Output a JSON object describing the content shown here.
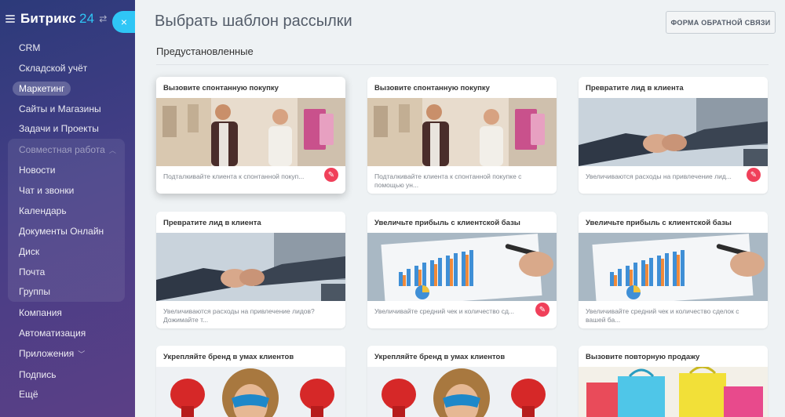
{
  "sidebar": {
    "logo_text": "Битрикс",
    "logo_number": "24",
    "pin_glyph": "⇄",
    "items": [
      {
        "label": "CRM"
      },
      {
        "label": "Складской учёт"
      },
      {
        "label": "Маркетинг"
      },
      {
        "label": "Сайты и Магазины"
      },
      {
        "label": "Задачи и Проекты"
      },
      {
        "label": "Совместная работа"
      },
      {
        "label": "Новости"
      },
      {
        "label": "Чат и звонки"
      },
      {
        "label": "Календарь"
      },
      {
        "label": "Документы Онлайн"
      },
      {
        "label": "Диск"
      },
      {
        "label": "Почта"
      },
      {
        "label": "Группы"
      },
      {
        "label": "Компания"
      },
      {
        "label": "Автоматизация"
      },
      {
        "label": "Приложения"
      },
      {
        "label": "Подпись"
      },
      {
        "label": "Ещё"
      }
    ]
  },
  "close_glyph": "×",
  "header": {
    "title": "Выбрать шаблон рассылки",
    "feedback_button": "ФОРМА ОБРАТНОЙ СВЯЗИ"
  },
  "section": {
    "title": "Предустановленные"
  },
  "cards": [
    {
      "title": "Вызовите спонтанную покупку",
      "desc": "Подталкивайте клиента к спонтанной покуп...",
      "image": "shopping-couple"
    },
    {
      "title": "Вызовите спонтанную покупку",
      "desc": "Подталкивайте клиента к спонтанной покупке с помощью ун...",
      "image": "shopping-couple"
    },
    {
      "title": "Превратите лид в клиента",
      "desc": "Увеличиваются расходы на привлечение лид...",
      "image": "handshake"
    },
    {
      "title": "Превратите лид в клиента",
      "desc": "Увеличиваются расходы на привлечение лидов? Дожимайте т...",
      "image": "handshake"
    },
    {
      "title": "Увеличьте прибыль с клиентской базы",
      "desc": "Увеличивайте средний чек и количество сд...",
      "image": "sales-chart"
    },
    {
      "title": "Увеличьте прибыль с клиентской базы",
      "desc": "Увеличивайте средний чек и количество сделок с вашей ба...",
      "image": "sales-chart"
    },
    {
      "title": "Укрепляйте бренд в умах клиентов",
      "desc": "",
      "image": "superhero-kid"
    },
    {
      "title": "Укрепляйте бренд в умах клиентов",
      "desc": "",
      "image": "superhero-kid"
    },
    {
      "title": "Вызовите повторную продажу",
      "desc": "",
      "image": "shopping-bags"
    }
  ],
  "colors": {
    "accent": "#2fc6f6",
    "edit_icon": "#f0405a"
  },
  "icons": {
    "edit": "pencil-icon"
  }
}
